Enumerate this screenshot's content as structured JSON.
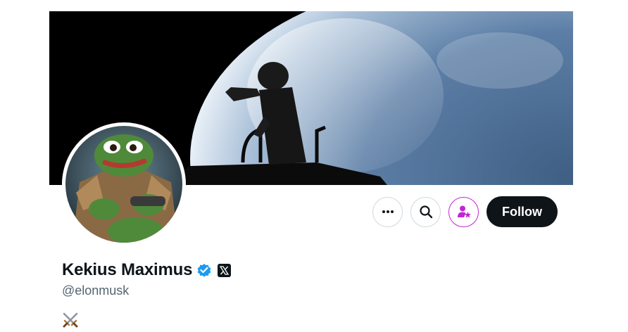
{
  "profile": {
    "display_name": "Kekius Maximus",
    "handle": "@elonmusk",
    "bio_emoji": "⚔️",
    "verified_badge": "blue-check-icon",
    "affiliation_badge": "x-logo-icon"
  },
  "actions": {
    "more_icon": "more-icon",
    "search_icon": "search-icon",
    "subscribe_icon": "subscribe-icon",
    "follow_label": "Follow"
  },
  "colors": {
    "follow_bg": "#0f1419",
    "verified": "#1d9bf0",
    "subscribe_accent": "#c026d3",
    "handle_text": "#536471"
  }
}
